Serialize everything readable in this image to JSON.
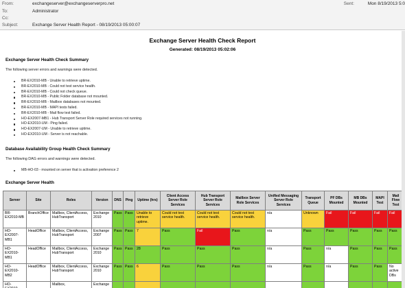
{
  "email": {
    "from_label": "From:",
    "from": "exchangeserver@exchangeserverpro.net",
    "to_label": "To:",
    "to": "Administrator",
    "cc_label": "Cc:",
    "cc": "",
    "subject_label": "Subject:",
    "subject": "Exchange Server Health Report - 08/19/2013 05:00:07",
    "sent_label": "Sent:",
    "sent": "Mon 8/19/2013 5:0"
  },
  "report": {
    "title": "Exchange Server Health Check Report",
    "generated": "Generated: 08/19/2013 05:02:06",
    "summary_heading": "Exchange Server Health Check Summary",
    "summary_intro": "The following server errors and warnings were detected.",
    "summary_items": [
      "BR-EX2010-MB - Unable to retrieve uptime.",
      "BR-EX2010-MB - Could not test service health.",
      "BR-EX2010-MB - Could not check queue.",
      "BR-EX2010-MB - Public Folder database not mounted.",
      "BR-EX2010-MB - Mailbox databases not mounted.",
      "BR-EX2010-MB - MAPI tests failed.",
      "BR-EX2010-MB - Mail flow test failed.",
      "HO-EX2007-MB1 - Hub Transport Server Role required services not running.",
      "HO-EX2010-UM - Ping failed.",
      "HO-EX2007-UM - Unable to retrieve uptime.",
      "HO-EX2010-UM - Server is not reachable."
    ],
    "dag_heading": "Database Availability Group Health Check Summary",
    "dag_intro": "The following DAG errors and warnings were detected.",
    "dag_items": [
      "MB-HO-03 - mounted on server that is activation preference 2"
    ],
    "health_heading": "Exchange Server Health"
  },
  "table": {
    "headers": [
      "Server",
      "Site",
      "Roles",
      "Version",
      "DNS",
      "Ping",
      "Uptime (hrs)",
      "Client Access Server Role Services",
      "Hub Transport Server Role Services",
      "Mailbox Server Role Services",
      "Unified Messaging Server Role Services",
      "Transport Queue",
      "PF DBs Mounted",
      "MB DBs Mounted",
      "MAPI Test",
      "Mail Flow Test"
    ],
    "rows": [
      {
        "cells": [
          "BR-EX2010-MB",
          "BranchOffice",
          "Mailbox, ClientAccess, HubTransport",
          "Exchange 2010",
          "Pass",
          "Pass",
          "Unable to retrieve uptime.",
          "Could not test service health.",
          "Could not test service health.",
          "Could not test service health.",
          "n/a",
          "Unknown",
          "Fail",
          "Fail",
          "Fail",
          "Fail"
        ],
        "status": [
          "plain",
          "plain",
          "plain",
          "plain",
          "pass",
          "pass",
          "warn",
          "warn",
          "warn",
          "warn",
          "plain",
          "warn",
          "fail",
          "fail",
          "fail",
          "fail"
        ]
      },
      {
        "cells": [
          "HO-EX2007-MB1",
          "HeadOffice",
          "Mailbox, ClientAccess, HubTransport",
          "Exchange 2007",
          "Pass",
          "Pass",
          "7",
          "Pass",
          "Fail",
          "Pass",
          "n/a",
          "Pass",
          "Pass",
          "Pass",
          "Pass",
          "Pass"
        ],
        "status": [
          "plain",
          "plain",
          "plain",
          "plain",
          "pass",
          "pass",
          "warn",
          "pass",
          "fail",
          "pass",
          "plain",
          "pass",
          "pass",
          "pass",
          "pass",
          "pass"
        ]
      },
      {
        "cells": [
          "HO-EX2010-MB1",
          "HeadOffice",
          "Mailbox, ClientAccess, HubTransport",
          "Exchange 2010",
          "Pass",
          "Pass",
          "28",
          "Pass",
          "Pass",
          "Pass",
          "n/a",
          "Pass",
          "n/a",
          "Pass",
          "Pass",
          "Pass"
        ],
        "status": [
          "plain",
          "plain",
          "plain",
          "plain",
          "pass",
          "pass",
          "pass",
          "pass",
          "pass",
          "pass",
          "plain",
          "pass",
          "plain",
          "pass",
          "pass",
          "pass"
        ]
      },
      {
        "cells": [
          "HO-EX2010-MB2",
          "HeadOffice",
          "Mailbox, ClientAccess, HubTransport",
          "Exchange 2010",
          "Pass",
          "Pass",
          "6",
          "Pass",
          "Pass",
          "Pass",
          "n/a",
          "Pass",
          "n/a",
          "Pass",
          "Pass",
          "No active DBs"
        ],
        "status": [
          "plain",
          "plain",
          "plain",
          "plain",
          "pass",
          "pass",
          "warn",
          "pass",
          "pass",
          "pass",
          "plain",
          "pass",
          "plain",
          "pass",
          "pass",
          "plain"
        ]
      },
      {
        "cells": [
          "HO-EX2010-",
          "",
          "Mailbox,",
          "Exchange",
          "",
          "",
          "",
          "",
          "",
          "",
          "",
          "",
          "",
          "",
          "",
          ""
        ],
        "status": [
          "plain",
          "plain",
          "plain",
          "plain",
          "pass",
          "pass",
          "warn",
          "pass",
          "pass",
          "pass",
          "plain",
          "pass",
          "plain",
          "pass",
          "pass",
          "pass"
        ]
      }
    ]
  },
  "colors": {
    "pass": "#7dd33a",
    "warn": "#f9d23c",
    "fail": "#e8161b",
    "header_bg": "#d9d9d9"
  }
}
